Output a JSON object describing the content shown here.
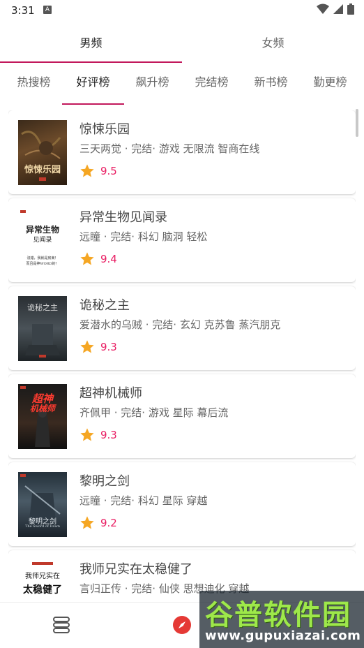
{
  "status_bar": {
    "time": "3:31",
    "notif_letter": "A"
  },
  "gender_tabs": [
    {
      "label": "男频",
      "active": true
    },
    {
      "label": "女频",
      "active": false
    }
  ],
  "rank_tabs": [
    {
      "label": "热搜榜",
      "active": false
    },
    {
      "label": "好评榜",
      "active": true
    },
    {
      "label": "飙升榜",
      "active": false
    },
    {
      "label": "完结榜",
      "active": false
    },
    {
      "label": "新书榜",
      "active": false
    },
    {
      "label": "勤更榜",
      "active": false
    }
  ],
  "books": [
    {
      "title": "惊悚乐园",
      "meta": "三天两觉 · 完结· 游戏 无限流 智商在线",
      "rating": "9.5",
      "cover_text": "惊悚乐园"
    },
    {
      "title": "异常生物见闻录",
      "meta": "远瞳 · 完结· 科幻 脑洞 轻松",
      "rating": "9.4",
      "cover_text": "异常生物",
      "cover_text2": "见闻录",
      "cover_text3": "沒錯，我就是房東！",
      "cover_text4": "而且是神WORD的！"
    },
    {
      "title": "诡秘之主",
      "meta": "爱潜水的乌贼 · 完结· 玄幻 克苏鲁 蒸汽朋克",
      "rating": "9.3",
      "cover_text": "诡秘之主"
    },
    {
      "title": "超神机械师",
      "meta": "齐佩甲 · 完结· 游戏 星际 幕后流",
      "rating": "9.3",
      "cover_text": "超神",
      "cover_text2": "机械师"
    },
    {
      "title": "黎明之剑",
      "meta": "远瞳 · 完结· 科幻 星际 穿越",
      "rating": "9.2",
      "cover_text": "黎明之剑",
      "cover_text2": "The Sword of Dawn"
    },
    {
      "title": "我师兄实在太稳健了",
      "meta": "言归正传 · 完结· 仙侠 思想迪化 穿越",
      "rating": "",
      "cover_text": "我师兄实在",
      "cover_text2": "太稳健了"
    }
  ],
  "watermark": {
    "title": "谷普软件园",
    "url": "www.gupuxiazai.com"
  },
  "colors": {
    "accent": "#c2185b",
    "rating": "#e91e63",
    "star": "#f5a623"
  }
}
